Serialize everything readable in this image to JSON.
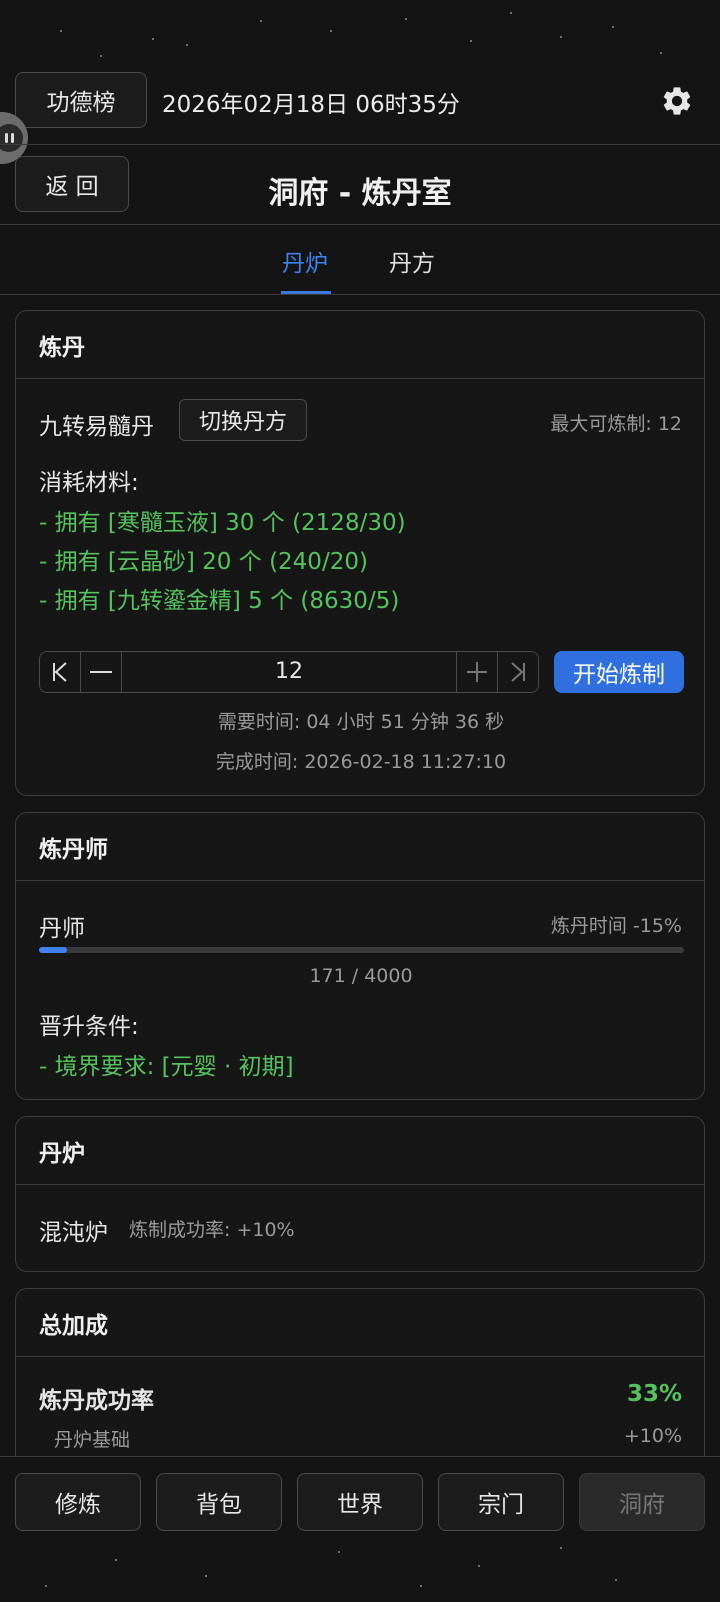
{
  "topbar": {
    "merit_button": "功德榜",
    "datetime": "2026年02月18日 06时35分"
  },
  "header": {
    "back_button": "返 回",
    "title": "洞府 - 炼丹室"
  },
  "tabs": [
    {
      "label": "丹炉",
      "active": true
    },
    {
      "label": "丹方",
      "active": false
    }
  ],
  "alchemy": {
    "title": "炼丹",
    "recipe_name": "九转易髓丹",
    "switch_button": "切换丹方",
    "max_craft": "最大可炼制: 12",
    "materials_label": "消耗材料:",
    "materials": [
      "- 拥有 [寒髓玉液] 30 个 (2128/30)",
      "- 拥有 [云晶砂] 20 个 (240/20)",
      "- 拥有 [九转鎏金精] 5 个 (8630/5)"
    ],
    "quantity": "12",
    "start_button": "开始炼制",
    "time_required": "需要时间: 04 小时 51 分钟 36 秒",
    "finish_time": "完成时间: 2026-02-18 11:27:10"
  },
  "alchemist": {
    "title": "炼丹师",
    "rank": "丹师",
    "bonus": "炼丹时间 -15%",
    "progress_text": "171 / 4000",
    "progress_fraction": 0.04275,
    "promote_label": "晋升条件:",
    "requirement": "- 境界要求: [元婴 · 初期]"
  },
  "furnace": {
    "title": "丹炉",
    "name": "混沌炉",
    "bonus": "炼制成功率: +10%"
  },
  "total": {
    "title": "总加成",
    "success_label": "炼丹成功率",
    "success_value": "33%",
    "base_label": "丹炉基础",
    "base_value": "+10%"
  },
  "nav": [
    {
      "label": "修炼",
      "disabled": false
    },
    {
      "label": "背包",
      "disabled": false
    },
    {
      "label": "世界",
      "disabled": false
    },
    {
      "label": "宗门",
      "disabled": false
    },
    {
      "label": "洞府",
      "disabled": true
    }
  ],
  "colors": {
    "accent": "#3f82ee",
    "success": "#56c25e",
    "background": "#141414"
  },
  "icons": {
    "settings": "gear-icon",
    "floating": "pause-icon",
    "stepper_first": "skip-first-icon",
    "stepper_minus": "minus-icon",
    "stepper_plus": "plus-icon",
    "stepper_last": "skip-last-icon"
  }
}
